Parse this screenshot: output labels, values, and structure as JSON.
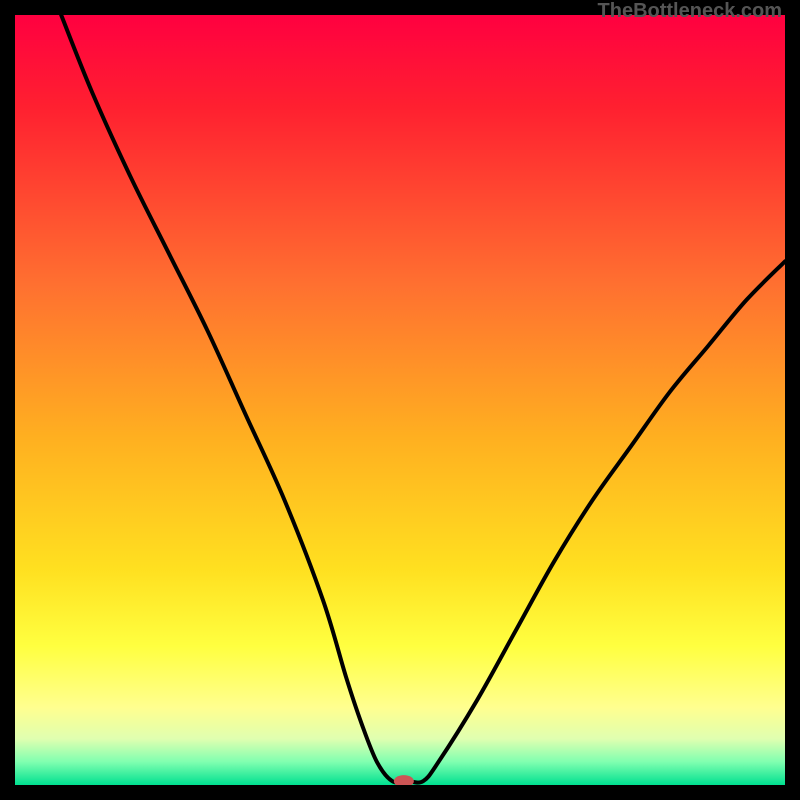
{
  "watermark": "TheBottleneck.com",
  "chart_data": {
    "type": "line",
    "title": "",
    "xlabel": "",
    "ylabel": "",
    "xlim": [
      0,
      100
    ],
    "ylim": [
      0,
      100
    ],
    "background_gradient": {
      "stops": [
        {
          "offset": 0.0,
          "color": "#ff0040"
        },
        {
          "offset": 0.12,
          "color": "#ff2030"
        },
        {
          "offset": 0.35,
          "color": "#ff7030"
        },
        {
          "offset": 0.55,
          "color": "#ffb020"
        },
        {
          "offset": 0.72,
          "color": "#ffe020"
        },
        {
          "offset": 0.82,
          "color": "#ffff40"
        },
        {
          "offset": 0.9,
          "color": "#ffff90"
        },
        {
          "offset": 0.94,
          "color": "#e0ffb0"
        },
        {
          "offset": 0.97,
          "color": "#80ffb0"
        },
        {
          "offset": 1.0,
          "color": "#00e090"
        }
      ]
    },
    "series": [
      {
        "name": "bottleneck-curve",
        "x": [
          6,
          10,
          15,
          20,
          25,
          30,
          35,
          40,
          43,
          45,
          47,
          49,
          51,
          53,
          55,
          60,
          65,
          70,
          75,
          80,
          85,
          90,
          95,
          100
        ],
        "values": [
          100,
          90,
          79,
          69,
          59,
          48,
          37,
          24,
          14,
          8,
          3,
          0.5,
          0.5,
          0.5,
          3,
          11,
          20,
          29,
          37,
          44,
          51,
          57,
          63,
          68
        ]
      }
    ],
    "marker": {
      "name": "bottleneck-marker",
      "x": 50.5,
      "y": 0.5,
      "color": "#cc5555",
      "rx": 10,
      "ry": 6
    }
  }
}
